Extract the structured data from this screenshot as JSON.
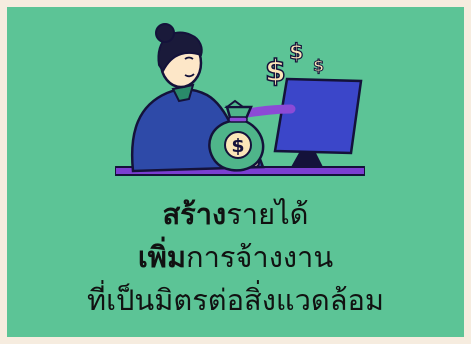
{
  "colors": {
    "page_background": "#f6ecdf",
    "card_background": "#5cc496",
    "text": "#111111",
    "outline": "#14123a",
    "sweater": "#2e4aa8",
    "hair": "#1a1a3a",
    "skin": "#fde7c8",
    "money_green": "#4fb58a",
    "money_bag_tie": "#8c4ad6",
    "monitor": "#3b46c9",
    "desk": "#7b3fd1",
    "dollar_sign": "#fbe6b8"
  },
  "illustration": {
    "icon": "woman-at-computer-with-money-bag-icon",
    "dollar_symbols": [
      "$",
      "$",
      "$",
      "$"
    ]
  },
  "caption": {
    "line1_bold": "สร้าง",
    "line1_rest": "รายได้",
    "line2_bold": "เพิ่ม",
    "line2_rest": "การจ้างงาน",
    "line3": "ที่เป็นมิตรต่อสิ่งแวดล้อม"
  }
}
